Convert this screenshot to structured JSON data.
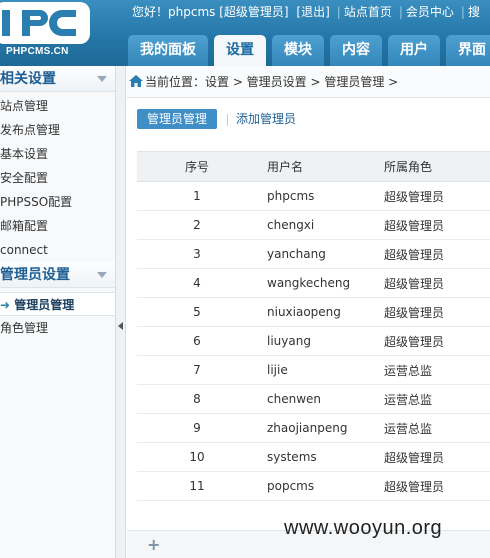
{
  "header": {
    "logo_text": "PHPCMS.CN",
    "topbar": {
      "greeting": "您好！phpcms [超级管理员]",
      "logout": "[退出]",
      "site_home": "站点首页",
      "member_center": "会员中心",
      "search": "搜"
    },
    "nav": [
      "我的面板",
      "设置",
      "模块",
      "内容",
      "用户",
      "界面"
    ]
  },
  "sidebar": {
    "section1_title": "相关设置",
    "section1_items": [
      "站点管理",
      "发布点管理",
      "基本设置",
      "安全配置",
      "PHPSSO配置",
      "邮箱配置",
      "connect"
    ],
    "section2_title": "管理员设置",
    "section2_items": [
      "管理员管理",
      "角色管理"
    ]
  },
  "breadcrumb": {
    "text": "当前位置：设置 > 管理员设置 > 管理员管理 >"
  },
  "subtabs": {
    "active": "管理员管理",
    "add": "添加管理员"
  },
  "table": {
    "headers": [
      "序号",
      "用户名",
      "所属角色"
    ],
    "rows": [
      [
        "1",
        "phpcms",
        "超级管理员"
      ],
      [
        "2",
        "chengxi",
        "超级管理员"
      ],
      [
        "3",
        "yanchang",
        "超级管理员"
      ],
      [
        "4",
        "wangkecheng",
        "超级管理员"
      ],
      [
        "5",
        "niuxiaopeng",
        "超级管理员"
      ],
      [
        "6",
        "liuyang",
        "超级管理员"
      ],
      [
        "7",
        "lijie",
        "运营总监"
      ],
      [
        "8",
        "chenwen",
        "运营总监"
      ],
      [
        "9",
        "zhaojianpeng",
        "运营总监"
      ],
      [
        "10",
        "systems",
        "超级管理员"
      ],
      [
        "11",
        "popcms",
        "超级管理员"
      ]
    ]
  },
  "watermark": "www.wooyun.org",
  "colors": {
    "header_blue": "#2a7fb0",
    "accent_button": "#3f8ec6",
    "link": "#1d5e94"
  }
}
